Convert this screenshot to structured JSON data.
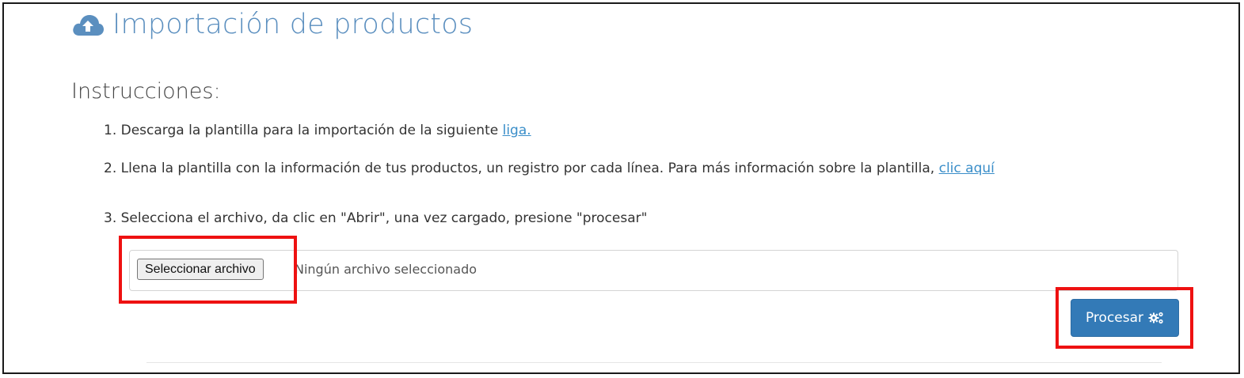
{
  "page": {
    "title": "Importación de productos",
    "title_icon": "cloud-upload-icon"
  },
  "instructions": {
    "heading": "Instrucciones:",
    "step1": {
      "prefix": "1. Descarga la plantilla para la importación de la siguiente ",
      "link": "liga."
    },
    "step2": {
      "prefix": "2. Llena la plantilla con la información de tus productos, un registro por cada línea. Para más información sobre la plantilla, ",
      "link": "clic aquí"
    },
    "step3": {
      "text": "3. Selecciona el archivo, da clic en \"Abrir\", una vez cargado, presione \"procesar\""
    }
  },
  "file_input": {
    "button_label": "Seleccionar archivo",
    "status": "Ningún archivo seleccionado"
  },
  "process_button": {
    "label": "Procesar",
    "icon": "gears-icon"
  },
  "colors": {
    "title": "#5b8fbf",
    "link": "#3a8ec9",
    "primary_button": "#337ab7",
    "highlight": "#ee1111"
  }
}
